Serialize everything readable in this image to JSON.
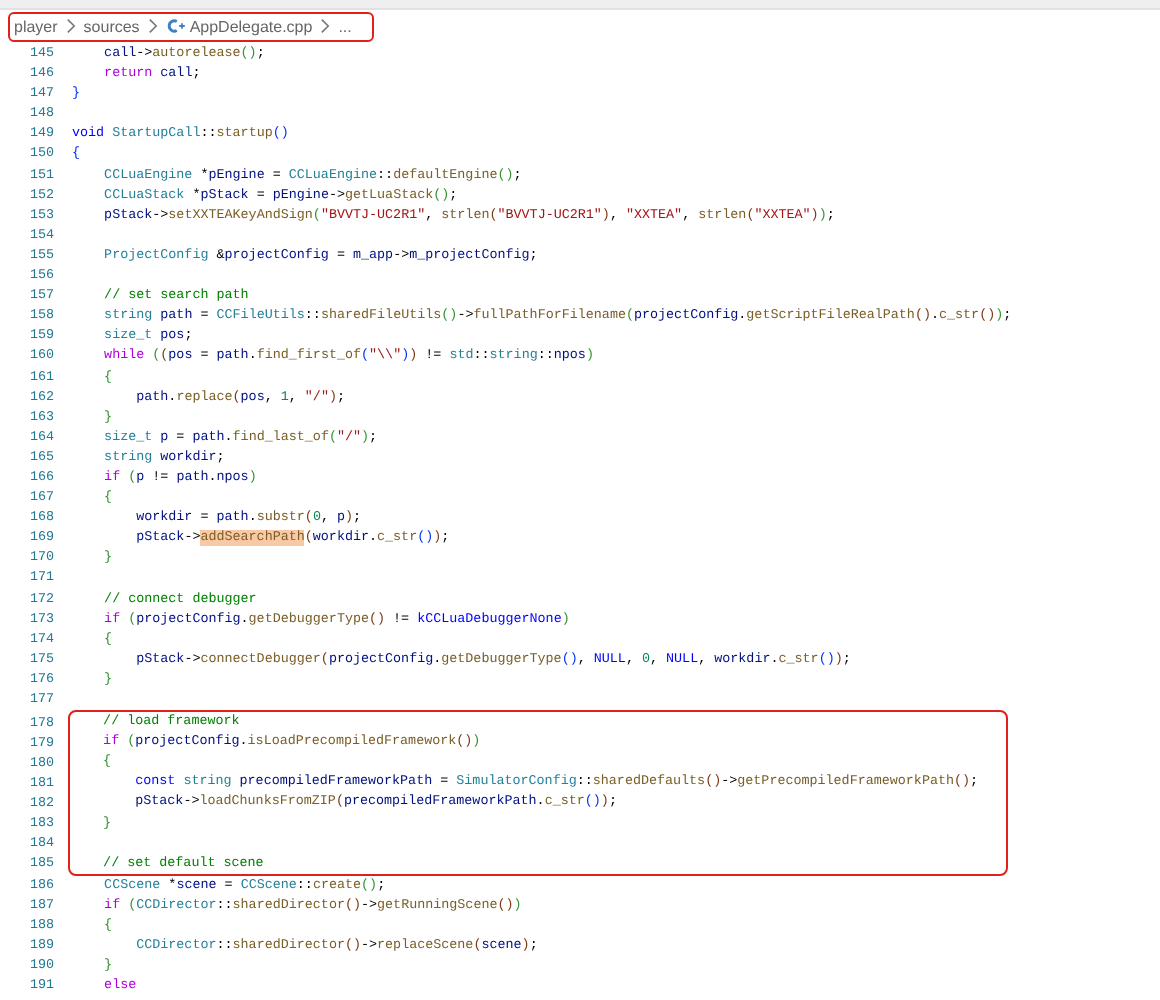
{
  "breadcrumb": {
    "items": [
      {
        "text": "player",
        "kind": "folder"
      },
      {
        "text": "sources",
        "kind": "folder"
      },
      {
        "text": "AppDelegate.cpp",
        "kind": "file"
      },
      {
        "text": "...",
        "kind": "more"
      }
    ]
  },
  "blocks": [
    {
      "framed": false,
      "lines": [
        {
          "number": "145",
          "tokens": [
            {
              "text": "    call",
              "kind": "v"
            },
            {
              "text": "->",
              "kind": "p"
            },
            {
              "text": "autorelease",
              "kind": "f"
            },
            {
              "text": "()",
              "kind": "b2"
            },
            {
              "text": ";",
              "kind": "p"
            }
          ]
        },
        {
          "number": "146",
          "tokens": [
            {
              "text": "    return ",
              "kind": "k"
            },
            {
              "text": "call",
              "kind": "v"
            },
            {
              "text": ";",
              "kind": "p"
            }
          ]
        },
        {
          "number": "147",
          "tokens": [
            {
              "text": "}",
              "kind": "b1"
            }
          ]
        },
        {
          "number": "148"
        },
        {
          "number": "149",
          "tokens": [
            {
              "text": "void ",
              "kind": "c"
            },
            {
              "text": "StartupCall",
              "kind": "t"
            },
            {
              "text": "::",
              "kind": "p"
            },
            {
              "text": "startup",
              "kind": "f"
            },
            {
              "text": "()",
              "kind": "b1"
            }
          ]
        },
        {
          "number": "150",
          "tokens": [
            {
              "text": "{",
              "kind": "b1"
            }
          ]
        },
        {
          "number": "151",
          "tokens": [
            {
              "text": "    CCLuaEngine ",
              "kind": "t"
            },
            {
              "text": "*",
              "kind": "p"
            },
            {
              "text": "pEngine",
              "kind": "v"
            },
            {
              "text": " = ",
              "kind": "p"
            },
            {
              "text": "CCLuaEngine",
              "kind": "t"
            },
            {
              "text": "::",
              "kind": "p"
            },
            {
              "text": "defaultEngine",
              "kind": "f"
            },
            {
              "text": "()",
              "kind": "b2"
            },
            {
              "text": ";",
              "kind": "p"
            }
          ]
        },
        {
          "number": "152",
          "tokens": [
            {
              "text": "    CCLuaStack ",
              "kind": "t"
            },
            {
              "text": "*",
              "kind": "p"
            },
            {
              "text": "pStack",
              "kind": "v"
            },
            {
              "text": " = ",
              "kind": "p"
            },
            {
              "text": "pEngine",
              "kind": "v"
            },
            {
              "text": "->",
              "kind": "p"
            },
            {
              "text": "getLuaStack",
              "kind": "f"
            },
            {
              "text": "()",
              "kind": "b2"
            },
            {
              "text": ";",
              "kind": "p"
            }
          ]
        },
        {
          "number": "153",
          "tokens": [
            {
              "text": "    pStack",
              "kind": "v"
            },
            {
              "text": "->",
              "kind": "p"
            },
            {
              "text": "setXXTEAKeyAndSign",
              "kind": "f"
            },
            {
              "text": "(",
              "kind": "b2"
            },
            {
              "text": "\"BVVTJ-UC2R1\"",
              "kind": "s"
            },
            {
              "text": ", ",
              "kind": "p"
            },
            {
              "text": "strlen",
              "kind": "f"
            },
            {
              "text": "(",
              "kind": "b3"
            },
            {
              "text": "\"BVVTJ-UC2R1\"",
              "kind": "s"
            },
            {
              "text": ")",
              "kind": "b3"
            },
            {
              "text": ", ",
              "kind": "p"
            },
            {
              "text": "\"XXTEA\"",
              "kind": "s"
            },
            {
              "text": ", ",
              "kind": "p"
            },
            {
              "text": "strlen",
              "kind": "f"
            },
            {
              "text": "(",
              "kind": "b3"
            },
            {
              "text": "\"XXTEA\"",
              "kind": "s"
            },
            {
              "text": ")",
              "kind": "b3"
            },
            {
              "text": ")",
              "kind": "b2"
            },
            {
              "text": ";",
              "kind": "p"
            }
          ]
        },
        {
          "number": "154"
        },
        {
          "number": "155",
          "tokens": [
            {
              "text": "    ProjectConfig ",
              "kind": "t"
            },
            {
              "text": "&",
              "kind": "p"
            },
            {
              "text": "projectConfig",
              "kind": "v"
            },
            {
              "text": " = ",
              "kind": "p"
            },
            {
              "text": "m_app",
              "kind": "v"
            },
            {
              "text": "->",
              "kind": "p"
            },
            {
              "text": "m_projectConfig",
              "kind": "v"
            },
            {
              "text": ";",
              "kind": "p"
            }
          ]
        },
        {
          "number": "156"
        },
        {
          "number": "157",
          "tokens": [
            {
              "text": "    // set search path",
              "kind": "m"
            }
          ]
        },
        {
          "number": "158",
          "tokens": [
            {
              "text": "    string ",
              "kind": "t"
            },
            {
              "text": "path",
              "kind": "v"
            },
            {
              "text": " = ",
              "kind": "p"
            },
            {
              "text": "CCFileUtils",
              "kind": "t"
            },
            {
              "text": "::",
              "kind": "p"
            },
            {
              "text": "sharedFileUtils",
              "kind": "f"
            },
            {
              "text": "()",
              "kind": "b2"
            },
            {
              "text": "->",
              "kind": "p"
            },
            {
              "text": "fullPathForFilename",
              "kind": "f"
            },
            {
              "text": "(",
              "kind": "b2"
            },
            {
              "text": "projectConfig",
              "kind": "v"
            },
            {
              "text": ".",
              "kind": "p"
            },
            {
              "text": "getScriptFileRealPath",
              "kind": "f"
            },
            {
              "text": "()",
              "kind": "b3"
            },
            {
              "text": ".",
              "kind": "p"
            },
            {
              "text": "c_str",
              "kind": "f"
            },
            {
              "text": "()",
              "kind": "b3"
            },
            {
              "text": ")",
              "kind": "b2"
            },
            {
              "text": ";",
              "kind": "p"
            }
          ]
        },
        {
          "number": "159",
          "tokens": [
            {
              "text": "    size_t ",
              "kind": "t"
            },
            {
              "text": "pos",
              "kind": "v"
            },
            {
              "text": ";",
              "kind": "p"
            }
          ]
        },
        {
          "number": "160",
          "tokens": [
            {
              "text": "    while ",
              "kind": "k"
            },
            {
              "text": "(",
              "kind": "b2"
            },
            {
              "text": "(",
              "kind": "b3"
            },
            {
              "text": "pos",
              "kind": "v"
            },
            {
              "text": " = ",
              "kind": "p"
            },
            {
              "text": "path",
              "kind": "v"
            },
            {
              "text": ".",
              "kind": "p"
            },
            {
              "text": "find_first_of",
              "kind": "f"
            },
            {
              "text": "(",
              "kind": "b1"
            },
            {
              "text": "\"\\\\\"",
              "kind": "s"
            },
            {
              "text": ")",
              "kind": "b1"
            },
            {
              "text": ")",
              "kind": "b3"
            },
            {
              "text": " != ",
              "kind": "p"
            },
            {
              "text": "std",
              "kind": "t"
            },
            {
              "text": "::",
              "kind": "p"
            },
            {
              "text": "string",
              "kind": "t"
            },
            {
              "text": "::",
              "kind": "p"
            },
            {
              "text": "npos",
              "kind": "v"
            },
            {
              "text": ")",
              "kind": "b2"
            }
          ]
        },
        {
          "number": "161",
          "tokens": [
            {
              "text": "    {",
              "kind": "b2"
            }
          ]
        },
        {
          "number": "162",
          "tokens": [
            {
              "text": "        path",
              "kind": "v"
            },
            {
              "text": ".",
              "kind": "p"
            },
            {
              "text": "replace",
              "kind": "f"
            },
            {
              "text": "(",
              "kind": "b3"
            },
            {
              "text": "pos",
              "kind": "v"
            },
            {
              "text": ", ",
              "kind": "p"
            },
            {
              "text": "1",
              "kind": "n"
            },
            {
              "text": ", ",
              "kind": "p"
            },
            {
              "text": "\"/\"",
              "kind": "s"
            },
            {
              "text": ")",
              "kind": "b3"
            },
            {
              "text": ";",
              "kind": "p"
            }
          ]
        },
        {
          "number": "163",
          "tokens": [
            {
              "text": "    }",
              "kind": "b2"
            }
          ]
        },
        {
          "number": "164",
          "tokens": [
            {
              "text": "    size_t ",
              "kind": "t"
            },
            {
              "text": "p",
              "kind": "v"
            },
            {
              "text": " = ",
              "kind": "p"
            },
            {
              "text": "path",
              "kind": "v"
            },
            {
              "text": ".",
              "kind": "p"
            },
            {
              "text": "find_last_of",
              "kind": "f"
            },
            {
              "text": "(",
              "kind": "b2"
            },
            {
              "text": "\"/\"",
              "kind": "s"
            },
            {
              "text": ")",
              "kind": "b2"
            },
            {
              "text": ";",
              "kind": "p"
            }
          ]
        },
        {
          "number": "165",
          "tokens": [
            {
              "text": "    string ",
              "kind": "t"
            },
            {
              "text": "workdir",
              "kind": "v"
            },
            {
              "text": ";",
              "kind": "p"
            }
          ]
        },
        {
          "number": "166",
          "tokens": [
            {
              "text": "    if ",
              "kind": "k"
            },
            {
              "text": "(",
              "kind": "b2"
            },
            {
              "text": "p",
              "kind": "v"
            },
            {
              "text": " != ",
              "kind": "p"
            },
            {
              "text": "path",
              "kind": "v"
            },
            {
              "text": ".",
              "kind": "p"
            },
            {
              "text": "npos",
              "kind": "v"
            },
            {
              "text": ")",
              "kind": "b2"
            }
          ]
        },
        {
          "number": "167",
          "tokens": [
            {
              "text": "    {",
              "kind": "b2"
            }
          ]
        },
        {
          "number": "168",
          "tokens": [
            {
              "text": "        workdir",
              "kind": "v"
            },
            {
              "text": " = ",
              "kind": "p"
            },
            {
              "text": "path",
              "kind": "v"
            },
            {
              "text": ".",
              "kind": "p"
            },
            {
              "text": "substr",
              "kind": "f"
            },
            {
              "text": "(",
              "kind": "b3"
            },
            {
              "text": "0",
              "kind": "n"
            },
            {
              "text": ", ",
              "kind": "p"
            },
            {
              "text": "p",
              "kind": "v"
            },
            {
              "text": ")",
              "kind": "b3"
            },
            {
              "text": ";",
              "kind": "p"
            }
          ]
        },
        {
          "number": "169",
          "tokens": [
            {
              "text": "        pStack",
              "kind": "v"
            },
            {
              "text": "->",
              "kind": "p"
            },
            {
              "text": "addSearchPath",
              "kind": "h"
            },
            {
              "text": "(",
              "kind": "b3"
            },
            {
              "text": "workdir",
              "kind": "v"
            },
            {
              "text": ".",
              "kind": "p"
            },
            {
              "text": "c_str",
              "kind": "f"
            },
            {
              "text": "()",
              "kind": "b1"
            },
            {
              "text": ")",
              "kind": "b3"
            },
            {
              "text": ";",
              "kind": "p"
            }
          ]
        },
        {
          "number": "170",
          "tokens": [
            {
              "text": "    }",
              "kind": "b2"
            }
          ]
        },
        {
          "number": "171"
        },
        {
          "number": "172",
          "tokens": [
            {
              "text": "    // connect debugger",
              "kind": "m"
            }
          ]
        },
        {
          "number": "173",
          "tokens": [
            {
              "text": "    if ",
              "kind": "k"
            },
            {
              "text": "(",
              "kind": "b2"
            },
            {
              "text": "projectConfig",
              "kind": "v"
            },
            {
              "text": ".",
              "kind": "p"
            },
            {
              "text": "getDebuggerType",
              "kind": "f"
            },
            {
              "text": "()",
              "kind": "b3"
            },
            {
              "text": " != ",
              "kind": "p"
            },
            {
              "text": "kCCLuaDebuggerNone",
              "kind": "c"
            },
            {
              "text": ")",
              "kind": "b2"
            }
          ]
        },
        {
          "number": "174",
          "tokens": [
            {
              "text": "    {",
              "kind": "b2"
            }
          ]
        },
        {
          "number": "175",
          "tokens": [
            {
              "text": "        pStack",
              "kind": "v"
            },
            {
              "text": "->",
              "kind": "p"
            },
            {
              "text": "connectDebugger",
              "kind": "f"
            },
            {
              "text": "(",
              "kind": "b3"
            },
            {
              "text": "projectConfig",
              "kind": "v"
            },
            {
              "text": ".",
              "kind": "p"
            },
            {
              "text": "getDebuggerType",
              "kind": "f"
            },
            {
              "text": "()",
              "kind": "b1"
            },
            {
              "text": ", ",
              "kind": "p"
            },
            {
              "text": "NULL",
              "kind": "c"
            },
            {
              "text": ", ",
              "kind": "p"
            },
            {
              "text": "0",
              "kind": "n"
            },
            {
              "text": ", ",
              "kind": "p"
            },
            {
              "text": "NULL",
              "kind": "c"
            },
            {
              "text": ", ",
              "kind": "p"
            },
            {
              "text": "workdir",
              "kind": "v"
            },
            {
              "text": ".",
              "kind": "p"
            },
            {
              "text": "c_str",
              "kind": "f"
            },
            {
              "text": "()",
              "kind": "b1"
            },
            {
              "text": ")",
              "kind": "b3"
            },
            {
              "text": ";",
              "kind": "p"
            }
          ]
        },
        {
          "number": "176",
          "tokens": [
            {
              "text": "    }",
              "kind": "b2"
            }
          ]
        },
        {
          "number": "177"
        }
      ]
    },
    {
      "framed": true,
      "lines": [
        {
          "number": "178",
          "tokens": [
            {
              "text": "    // load framework",
              "kind": "m"
            }
          ]
        },
        {
          "number": "179",
          "tokens": [
            {
              "text": "    if ",
              "kind": "k"
            },
            {
              "text": "(",
              "kind": "b2"
            },
            {
              "text": "projectConfig",
              "kind": "v"
            },
            {
              "text": ".",
              "kind": "p"
            },
            {
              "text": "isLoadPrecompiledFramework",
              "kind": "f"
            },
            {
              "text": "()",
              "kind": "b3"
            },
            {
              "text": ")",
              "kind": "b2"
            }
          ]
        },
        {
          "number": "180",
          "tokens": [
            {
              "text": "    {",
              "kind": "b2"
            }
          ]
        },
        {
          "number": "181",
          "tokens": [
            {
              "text": "        const ",
              "kind": "c"
            },
            {
              "text": "string ",
              "kind": "t"
            },
            {
              "text": "precompiledFrameworkPath",
              "kind": "v"
            },
            {
              "text": " = ",
              "kind": "p"
            },
            {
              "text": "SimulatorConfig",
              "kind": "t"
            },
            {
              "text": "::",
              "kind": "p"
            },
            {
              "text": "sharedDefaults",
              "kind": "f"
            },
            {
              "text": "()",
              "kind": "b3"
            },
            {
              "text": "->",
              "kind": "p"
            },
            {
              "text": "getPrecompiledFrameworkPath",
              "kind": "f"
            },
            {
              "text": "()",
              "kind": "b3"
            },
            {
              "text": ";",
              "kind": "p"
            }
          ]
        },
        {
          "number": "182",
          "tokens": [
            {
              "text": "        pStack",
              "kind": "v"
            },
            {
              "text": "->",
              "kind": "p"
            },
            {
              "text": "loadChunksFromZIP",
              "kind": "f"
            },
            {
              "text": "(",
              "kind": "b3"
            },
            {
              "text": "precompiledFrameworkPath",
              "kind": "v"
            },
            {
              "text": ".",
              "kind": "p"
            },
            {
              "text": "c_str",
              "kind": "f"
            },
            {
              "text": "()",
              "kind": "b1"
            },
            {
              "text": ")",
              "kind": "b3"
            },
            {
              "text": ";",
              "kind": "p"
            }
          ]
        },
        {
          "number": "183",
          "tokens": [
            {
              "text": "    }",
              "kind": "b2"
            }
          ]
        },
        {
          "number": "184"
        },
        {
          "number": "185",
          "tokens": [
            {
              "text": "    // set default scene",
              "kind": "m"
            }
          ]
        }
      ]
    },
    {
      "framed": false,
      "lines": [
        {
          "number": "186",
          "tokens": [
            {
              "text": "    CCScene ",
              "kind": "t"
            },
            {
              "text": "*",
              "kind": "p"
            },
            {
              "text": "scene",
              "kind": "v"
            },
            {
              "text": " = ",
              "kind": "p"
            },
            {
              "text": "CCScene",
              "kind": "t"
            },
            {
              "text": "::",
              "kind": "p"
            },
            {
              "text": "create",
              "kind": "f"
            },
            {
              "text": "()",
              "kind": "b2"
            },
            {
              "text": ";",
              "kind": "p"
            }
          ]
        },
        {
          "number": "187",
          "tokens": [
            {
              "text": "    if ",
              "kind": "k"
            },
            {
              "text": "(",
              "kind": "b2"
            },
            {
              "text": "CCDirector",
              "kind": "t"
            },
            {
              "text": "::",
              "kind": "p"
            },
            {
              "text": "sharedDirector",
              "kind": "f"
            },
            {
              "text": "()",
              "kind": "b3"
            },
            {
              "text": "->",
              "kind": "p"
            },
            {
              "text": "getRunningScene",
              "kind": "f"
            },
            {
              "text": "()",
              "kind": "b3"
            },
            {
              "text": ")",
              "kind": "b2"
            }
          ]
        },
        {
          "number": "188",
          "tokens": [
            {
              "text": "    {",
              "kind": "b2"
            }
          ]
        },
        {
          "number": "189",
          "tokens": [
            {
              "text": "        CCDirector",
              "kind": "t"
            },
            {
              "text": "::",
              "kind": "p"
            },
            {
              "text": "sharedDirector",
              "kind": "f"
            },
            {
              "text": "()",
              "kind": "b3"
            },
            {
              "text": "->",
              "kind": "p"
            },
            {
              "text": "replaceScene",
              "kind": "f"
            },
            {
              "text": "(",
              "kind": "b3"
            },
            {
              "text": "scene",
              "kind": "v"
            },
            {
              "text": ")",
              "kind": "b3"
            },
            {
              "text": ";",
              "kind": "p"
            }
          ]
        },
        {
          "number": "190",
          "tokens": [
            {
              "text": "    }",
              "kind": "b2"
            }
          ]
        },
        {
          "number": "191",
          "tokens": [
            {
              "text": "    else",
              "kind": "k"
            }
          ]
        }
      ]
    }
  ]
}
